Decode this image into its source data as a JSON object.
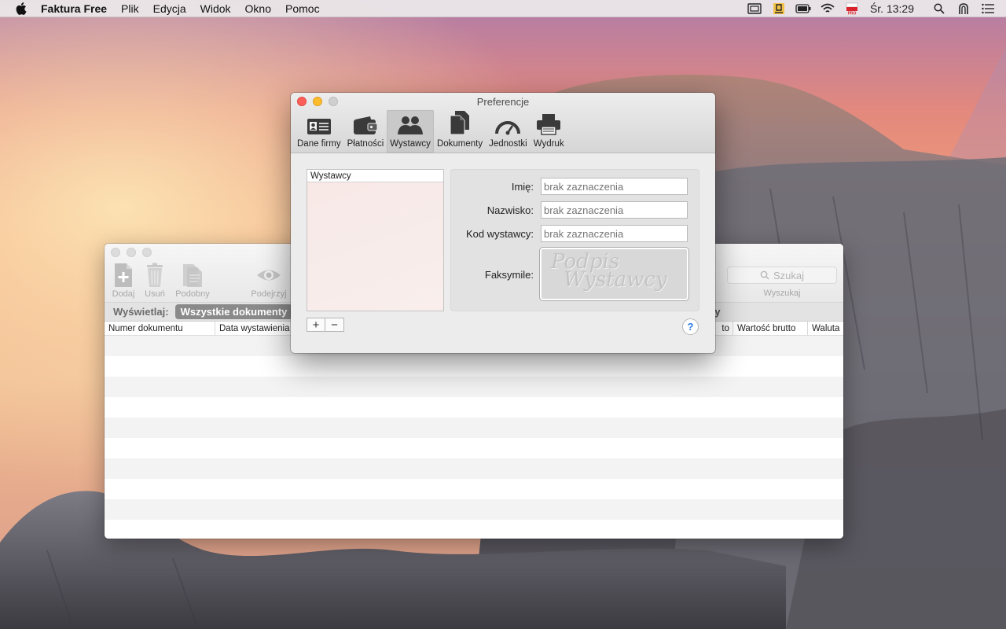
{
  "menubar": {
    "app_name": "Faktura Free",
    "items": [
      "Plik",
      "Edycja",
      "Widok",
      "Okno",
      "Pomoc"
    ],
    "clock": "Śr. 13:29",
    "status_icons": [
      "display-icon",
      "gdrive-icon",
      "battery-icon",
      "wifi-icon",
      "flag-pro-icon",
      "search-icon",
      "user-icon",
      "list-icon"
    ]
  },
  "main_window": {
    "toolbar": {
      "add": "Dodaj",
      "delete": "Usuń",
      "similar": "Podobny",
      "preview": "Podejrzyj"
    },
    "search": {
      "placeholder": "Szukaj",
      "label": "Wyszukaj"
    },
    "filter": {
      "label": "Wyświetlaj:",
      "selected": "Wszystkie dokumenty",
      "other": "ty"
    },
    "columns": [
      "Numer dokumentu",
      "Data wystawienia",
      "to",
      "Wartość brutto",
      "Waluta"
    ],
    "row_count": 10
  },
  "preferences": {
    "title": "Preferencje",
    "tabs": [
      {
        "label": "Dane firmy",
        "icon": "id-card-icon"
      },
      {
        "label": "Płatności",
        "icon": "wallet-icon"
      },
      {
        "label": "Wystawcy",
        "icon": "people-icon"
      },
      {
        "label": "Dokumenty",
        "icon": "documents-icon"
      },
      {
        "label": "Jednostki",
        "icon": "gauge-icon"
      },
      {
        "label": "Wydruk",
        "icon": "printer-icon"
      }
    ],
    "selected_tab": "Wystawcy",
    "list_header": "Wystawcy",
    "add_symbol": "+",
    "remove_symbol": "−",
    "fields": {
      "first_name": {
        "label": "Imię:",
        "placeholder": "brak zaznaczenia"
      },
      "last_name": {
        "label": "Nazwisko:",
        "placeholder": "brak zaznaczenia"
      },
      "issuer_code": {
        "label": "Kod wystawcy:",
        "placeholder": "brak zaznaczenia"
      },
      "facsimile": {
        "label": "Faksymile:",
        "line1": "Podpis",
        "line2": "Wystawcy"
      }
    },
    "help_symbol": "?"
  },
  "colors": {
    "close": "#fc5f57",
    "minimize": "#fdbc2e",
    "selected_tab": "#c9c9c9",
    "help_accent": "#2c7be5"
  }
}
